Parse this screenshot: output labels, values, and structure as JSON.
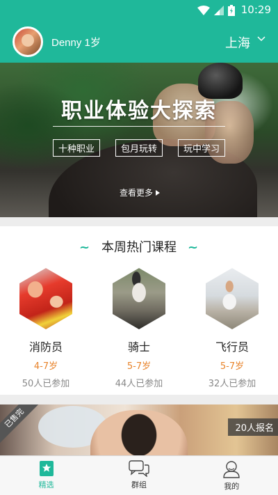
{
  "status_bar": {
    "time": "10:29"
  },
  "header": {
    "username": "Denny 1岁",
    "city": "上海"
  },
  "banner": {
    "title": "职业体验大探索",
    "tags": [
      "十种职业",
      "包月玩转",
      "玩中学习"
    ],
    "see_more": "查看更多"
  },
  "hot_courses": {
    "title": "本周热门课程",
    "items": [
      {
        "name": "消防员",
        "age": "4-7岁",
        "count": "50人已参加"
      },
      {
        "name": "骑士",
        "age": "5-7岁",
        "count": "44人已参加"
      },
      {
        "name": "飞行员",
        "age": "5-7岁",
        "count": "32人已参加"
      }
    ]
  },
  "card2": {
    "sold_label": "已售完",
    "signup": "20人报名"
  },
  "tabbar": {
    "tabs": [
      {
        "label": "精选",
        "icon": "star-bookmark-icon",
        "active": true
      },
      {
        "label": "群组",
        "icon": "chat-bubbles-icon",
        "active": false
      },
      {
        "label": "我的",
        "icon": "person-icon",
        "active": false
      }
    ]
  },
  "colors": {
    "accent": "#1fb89a",
    "age_orange": "#e8832a"
  }
}
